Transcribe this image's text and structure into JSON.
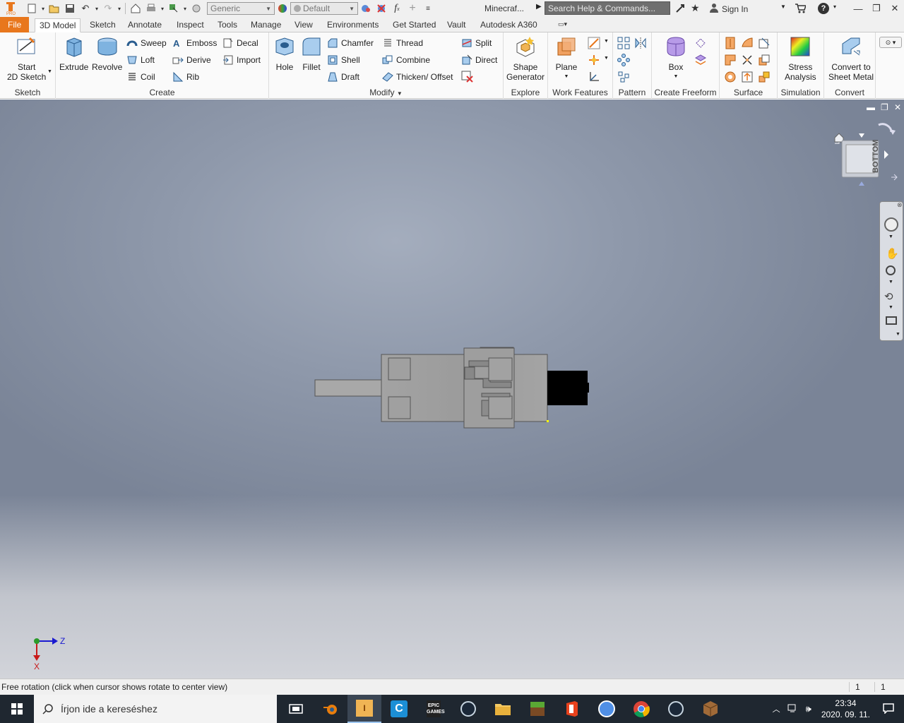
{
  "titlebar": {
    "material_combo": "Generic",
    "appearance_combo": "Default",
    "document_title": "Minecraf...",
    "search_placeholder": "Search Help & Commands...",
    "sign_in": "Sign In"
  },
  "tabs": [
    "File",
    "3D Model",
    "Sketch",
    "Annotate",
    "Inspect",
    "Tools",
    "Manage",
    "View",
    "Environments",
    "Get Started",
    "Vault",
    "Autodesk A360"
  ],
  "ribbon": {
    "sketch": {
      "title": "Sketch",
      "start_line1": "Start",
      "start_line2": "2D Sketch"
    },
    "create": {
      "title": "Create",
      "extrude": "Extrude",
      "revolve": "Revolve",
      "sweep": "Sweep",
      "loft": "Loft",
      "coil": "Coil",
      "emboss": "Emboss",
      "derive": "Derive",
      "rib": "Rib",
      "decal": "Decal",
      "import": "Import"
    },
    "modify": {
      "title": "Modify",
      "hole": "Hole",
      "fillet": "Fillet",
      "chamfer": "Chamfer",
      "shell": "Shell",
      "draft": "Draft",
      "thread": "Thread",
      "combine": "Combine",
      "thicken": "Thicken/ Offset",
      "split": "Split",
      "direct": "Direct"
    },
    "explore": {
      "title": "Explore",
      "shape_gen_line1": "Shape",
      "shape_gen_line2": "Generator"
    },
    "work_features": {
      "title": "Work Features",
      "plane": "Plane"
    },
    "pattern": {
      "title": "Pattern"
    },
    "freeform": {
      "title": "Create Freeform",
      "box": "Box"
    },
    "surface": {
      "title": "Surface"
    },
    "simulation": {
      "title": "Simulation",
      "stress_line1": "Stress",
      "stress_line2": "Analysis"
    },
    "convert": {
      "title": "Convert",
      "sheet_line1": "Convert to",
      "sheet_line2": "Sheet Metal"
    }
  },
  "viewcube": {
    "face_label": "BOTTOM"
  },
  "axis": {
    "horizontal": "Z",
    "vertical": "X"
  },
  "status": {
    "text": "Free rotation (click when cursor shows rotate to center view)",
    "count1": "1",
    "count2": "1"
  },
  "taskbar": {
    "search_placeholder": "Írjon ide a kereséshez",
    "time": "23:34",
    "date": "2020. 09. 11."
  },
  "colors": {
    "file_tab": "#e8771d",
    "taskbar": "#1f2730",
    "viewport_top": "#a4adbd",
    "viewport_bottom": "#d2d4da"
  }
}
